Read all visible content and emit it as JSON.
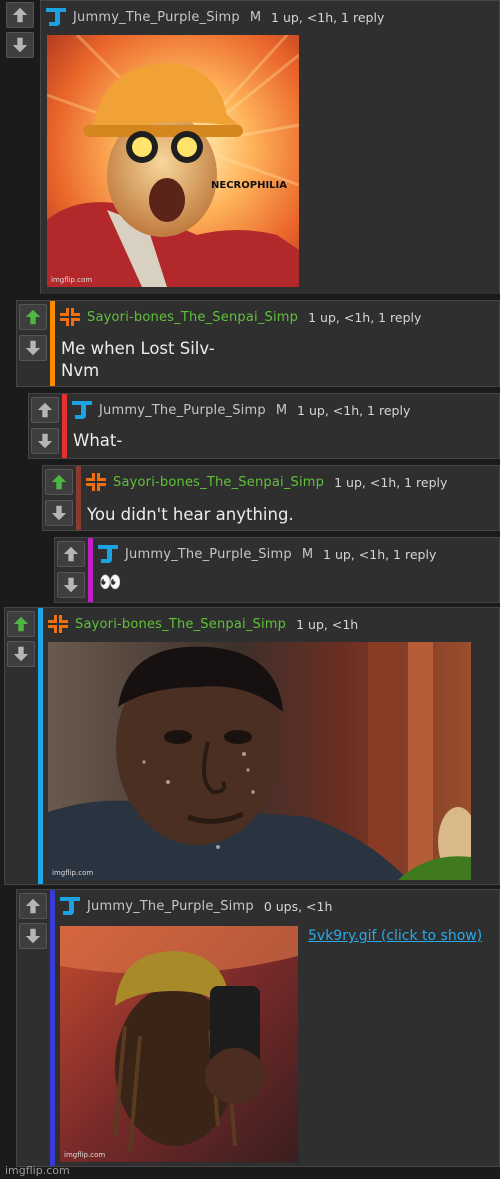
{
  "comments": [
    {
      "user": "Jummy_The_Purple_Simp",
      "mod": "M",
      "meta": "1 up, <1h, 1 reply",
      "image": {
        "caption": "NECROPHILIA",
        "watermark": "imgflip.com"
      }
    },
    {
      "user": "Sayori-bones_The_Senpai_Simp",
      "meta": "1 up, <1h, 1 reply",
      "line1": "Me when Lost Silv-",
      "line2": "Nvm"
    },
    {
      "user": "Jummy_The_Purple_Simp",
      "mod": "M",
      "meta": "1 up, <1h, 1 reply",
      "text": "What-"
    },
    {
      "user": "Sayori-bones_The_Senpai_Simp",
      "meta": "1 up, <1h, 1 reply",
      "text": "You didn't hear anything."
    },
    {
      "user": "Jummy_The_Purple_Simp",
      "mod": "M",
      "meta": "1 up, <1h, 1 reply",
      "text": "👀"
    },
    {
      "user": "Sayori-bones_The_Senpai_Simp",
      "meta": "1 up, <1h",
      "image": {
        "watermark": "imgflip.com"
      }
    },
    {
      "user": "Jummy_The_Purple_Simp",
      "meta": "0 ups, <1h",
      "link": "5vk9ry.gif (click to show)",
      "image": {
        "watermark": "imgflip.com"
      }
    }
  ],
  "site_watermark": "imgflip.com",
  "colors": {
    "upvoted": "#4cb843",
    "rail_orange": "#ff8c00",
    "rail_red": "#e53030",
    "rail_brown": "#8b3b2e",
    "rail_magenta": "#c21ec8",
    "rail_blue": "#1ea7e8",
    "rail_indigo": "#3a3ad8",
    "j_badge": "#1aa3e0",
    "s_badge": "#f0700f"
  }
}
